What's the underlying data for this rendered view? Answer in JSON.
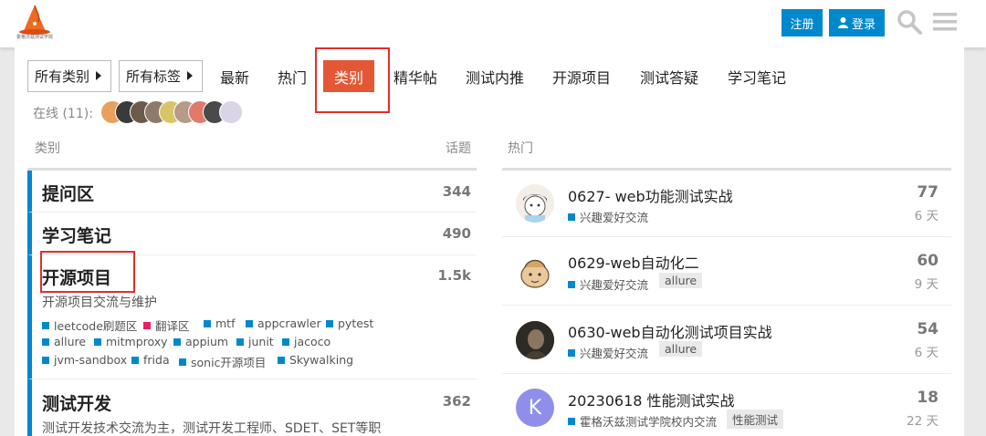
{
  "header": {
    "signup_label": "注册",
    "login_label": "登录",
    "logo_caption": "霍格沃兹测试学院"
  },
  "nav": {
    "all_categories": "所有类别",
    "all_tags": "所有标签",
    "items": [
      "最新",
      "热门",
      "类别",
      "精华帖",
      "测试内推",
      "开源项目",
      "测试答疑",
      "学习笔记"
    ],
    "active": "类别"
  },
  "online": {
    "label": "在线 (11):"
  },
  "categories": {
    "header_name": "类别",
    "header_count": "话题",
    "rows": [
      {
        "name": "提问区",
        "count": "344"
      },
      {
        "name": "学习笔记",
        "count": "490"
      },
      {
        "name": "开源项目",
        "count": "1.5k",
        "description": "开源项目交流与维护",
        "subcategories": [
          {
            "name": "leetcode刷题区",
            "color": "#0088cc"
          },
          {
            "name": "翻译区",
            "color": "#e91e63"
          },
          {
            "name": "mtf",
            "color": "#0088cc"
          },
          {
            "name": "appcrawler",
            "color": "#0088cc"
          },
          {
            "name": "pytest",
            "color": "#0088cc"
          },
          {
            "name": "allure",
            "color": "#0088cc"
          },
          {
            "name": "mitmproxy",
            "color": "#0088cc"
          },
          {
            "name": "appium",
            "color": "#0088cc"
          },
          {
            "name": "junit",
            "color": "#0088cc"
          },
          {
            "name": "jacoco",
            "color": "#0088cc"
          },
          {
            "name": "jvm-sandbox",
            "color": "#0088cc"
          },
          {
            "name": "frida",
            "color": "#0088cc"
          },
          {
            "name": "sonic开源项目",
            "color": "#0088cc"
          },
          {
            "name": "Skywalking",
            "color": "#0088cc"
          }
        ]
      },
      {
        "name": "测试开发",
        "count": "362",
        "description": "测试开发技术交流为主，测试开发工程师、SDET、SET等职"
      }
    ]
  },
  "hot": {
    "header": "热门",
    "topics": [
      {
        "title": "0627- web功能测试实战",
        "category": "兴趣爱好交流",
        "tag": "",
        "count": "77",
        "age": "6 天"
      },
      {
        "title": "0629-web自动化二",
        "category": "兴趣爱好交流",
        "tag": "allure",
        "count": "60",
        "age": "9 天"
      },
      {
        "title": "0630-web自动化测试项目实战",
        "category": "兴趣爱好交流",
        "tag": "allure",
        "count": "54",
        "age": "6 天"
      },
      {
        "title": "20230618 性能测试实战",
        "category": "霍格沃兹测试学院校内交流",
        "tag": "性能测试",
        "count": "18",
        "age": "22 天",
        "avatar_letter": "K"
      }
    ]
  },
  "colors": {
    "accent": "#0088cc",
    "active_nav": "#e45735",
    "highlight_box": "#e0302a"
  }
}
